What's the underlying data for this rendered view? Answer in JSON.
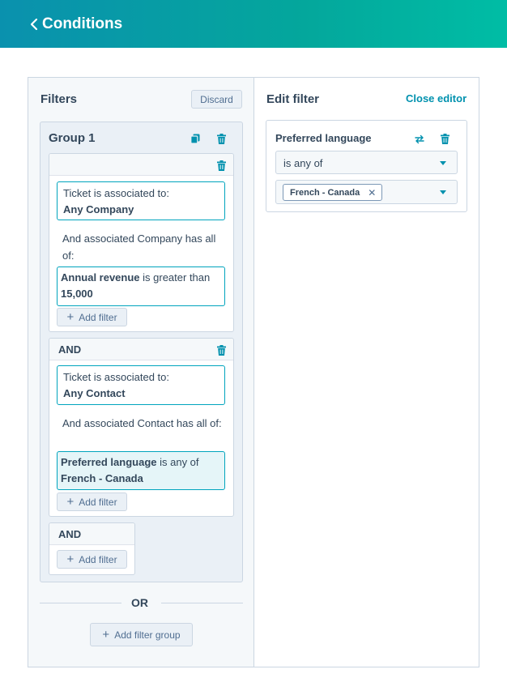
{
  "header": {
    "title": "Conditions",
    "back_icon": "chevron-left-icon"
  },
  "filters_pane": {
    "title": "Filters",
    "discard_label": "Discard",
    "group": {
      "title": "Group 1",
      "clone_icon": "copy-icon",
      "delete_icon": "trash-icon",
      "blocks": [
        {
          "association_line1": "Ticket is associated to:",
          "association_line2": "Any Company",
          "and_text": "And associated Company has all of:",
          "filter": {
            "property": "Annual revenue",
            "operator": " is greater than ",
            "value": "15,000"
          },
          "add_filter_label": "Add filter"
        },
        {
          "header_label": "AND",
          "association_line1": "Ticket is associated to:",
          "association_line2": "Any Contact",
          "and_text": "And associated Contact has all of:",
          "filter": {
            "property": "Preferred language",
            "operator": " is any of ",
            "value": "French - Canada"
          },
          "add_filter_label": "Add filter"
        },
        {
          "header_label": "AND",
          "add_filter_label": "Add filter"
        }
      ]
    },
    "or_label": "OR",
    "add_group_label": "Add filter group"
  },
  "editor": {
    "title": "Edit filter",
    "close_label": "Close editor",
    "property": "Preferred language",
    "swap_icon": "swap-icon",
    "delete_icon": "trash-icon",
    "operator_value": "is any of",
    "selected_tags": [
      "French - Canada"
    ]
  },
  "colors": {
    "header_gradient_start": "#0a91ae",
    "header_gradient_end": "#00bda5",
    "accent": "#0091ae",
    "border": "#cbd6e2",
    "active_filter_bg": "#e5f5f8"
  }
}
